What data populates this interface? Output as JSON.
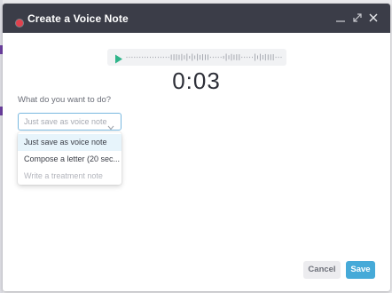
{
  "modal": {
    "title": "Create a Voice Note"
  },
  "player": {
    "elapsed": "0:03"
  },
  "form": {
    "question": "What do you want to do?",
    "select_value": "Just save as voice note",
    "options": [
      {
        "label": "Just save as voice note",
        "state": "selected"
      },
      {
        "label": "Compose a letter (20 sec...",
        "state": "normal"
      },
      {
        "label": "Write a treatment note",
        "state": "disabled"
      }
    ]
  },
  "footer": {
    "cancel_label": "Cancel",
    "save_label": "Save"
  },
  "colors": {
    "header_bg": "#3b3d48",
    "record_dot": "#e0414d",
    "play_accent": "#2fb48a",
    "select_border": "#79b8e0",
    "save_button": "#46aad8"
  },
  "icons": {
    "record": "record-dot-icon",
    "minimize": "minimize-icon",
    "expand": "expand-icon",
    "close": "close-icon",
    "play": "play-icon",
    "chevron": "chevron-down-icon"
  }
}
